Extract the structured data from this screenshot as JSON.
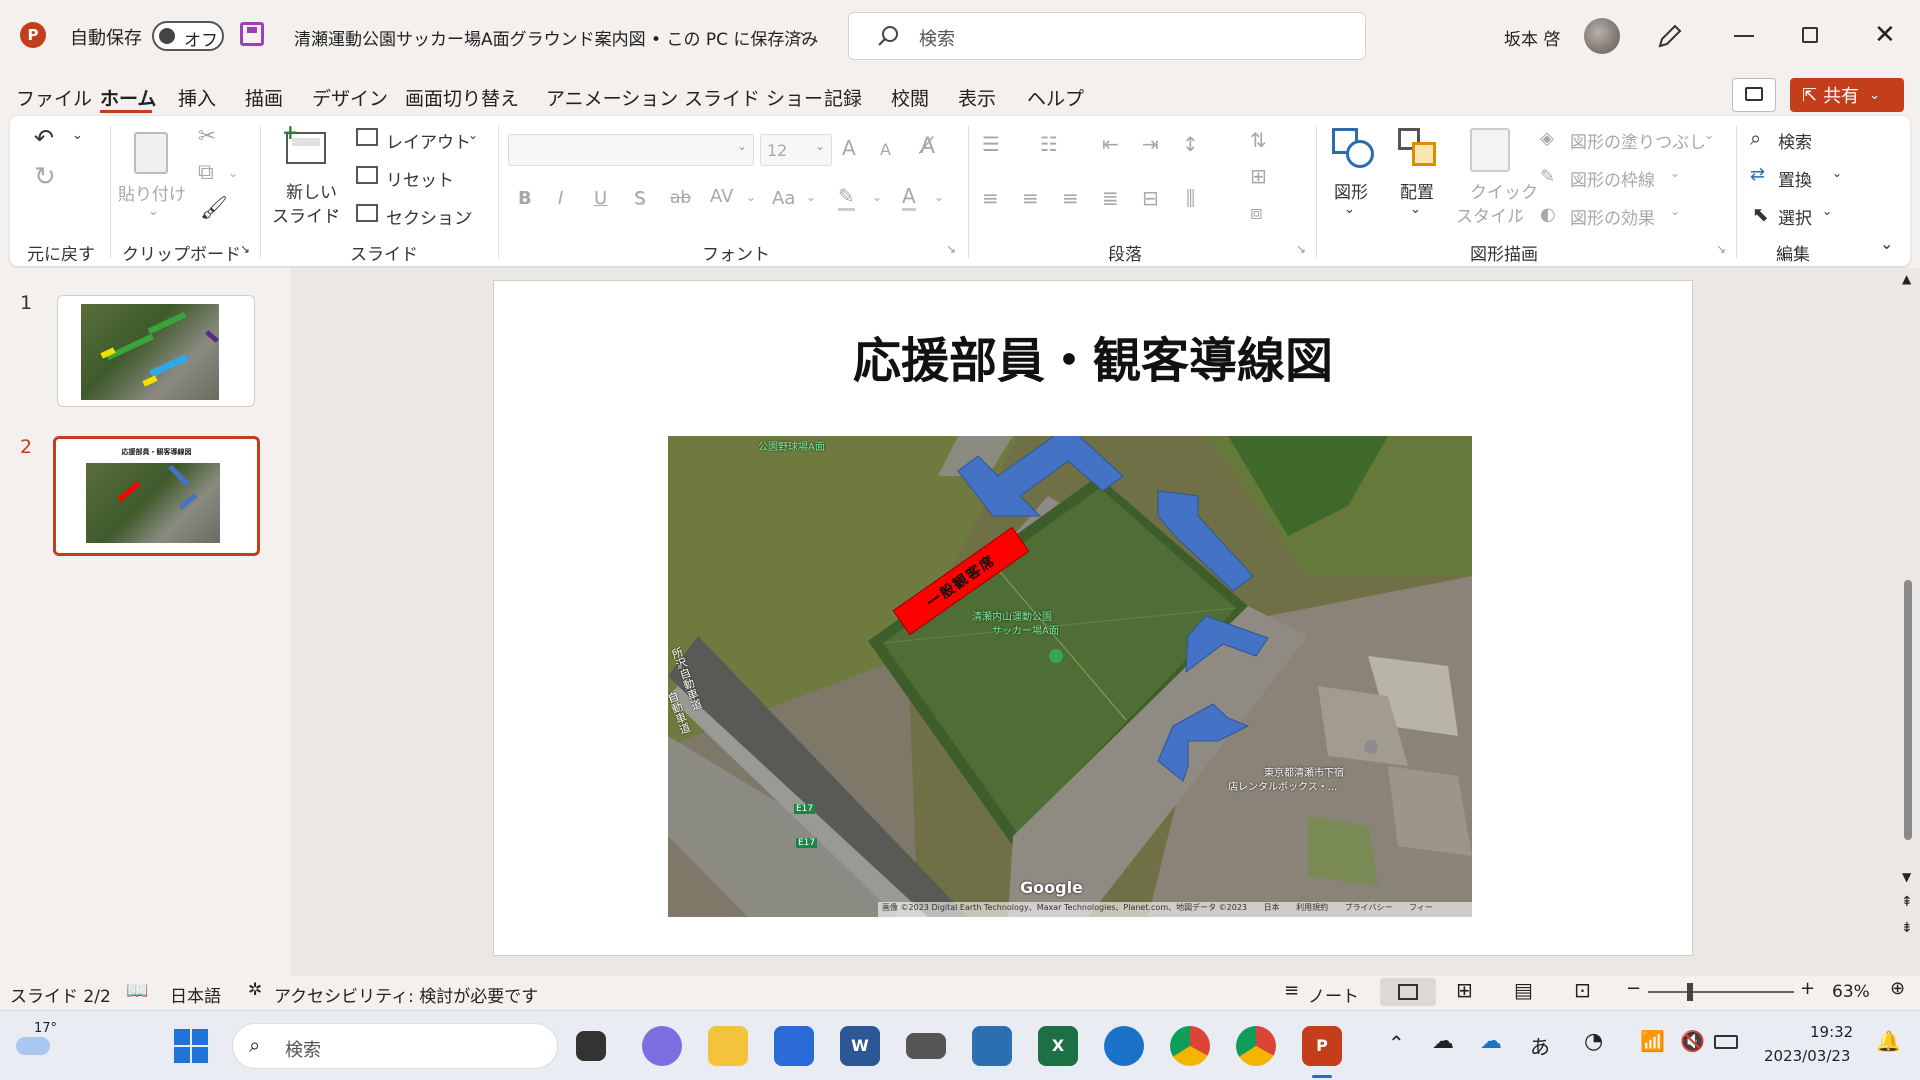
{
  "titlebar": {
    "autosave_label": "自動保存",
    "autosave_state": "オフ",
    "doc_title": "清瀬運動公園サッカー場A面グラウンド案内図 • この PC に保存済み",
    "search_placeholder": "検索",
    "user_name": "坂本 啓"
  },
  "menu": [
    "ファイル",
    "ホーム",
    "挿入",
    "描画",
    "デザイン",
    "画面切り替え",
    "アニメーション",
    "スライド ショー",
    "記録",
    "校閲",
    "表示",
    "ヘルプ"
  ],
  "share_label": "共有",
  "ribbon": {
    "undo_group": "元に戻す",
    "clipboard": {
      "paste": "貼り付け",
      "group": "クリップボード"
    },
    "slides": {
      "new_slide_1": "新しい",
      "new_slide_2": "スライド",
      "layout": "レイアウト",
      "reset": "リセット",
      "section": "セクション",
      "group": "スライド"
    },
    "font": {
      "size": "12",
      "group": "フォント",
      "bold": "B",
      "italic": "I",
      "underline": "U",
      "shadow": "S",
      "strike": "ab",
      "spacing": "AV",
      "case": "Aa",
      "grow": "A",
      "shrink": "A",
      "color": "A"
    },
    "paragraph": {
      "group": "段落"
    },
    "drawing": {
      "shapes": "図形",
      "arrange": "配置",
      "quick_1": "クイック",
      "quick_2": "スタイル",
      "fill": "図形の塗りつぶし",
      "outline": "図形の枠線",
      "effects": "図形の効果",
      "group": "図形描画"
    },
    "editing": {
      "find": "検索",
      "replace": "置換",
      "select": "選択",
      "group": "編集"
    }
  },
  "thumbnails": [
    {
      "number": "1"
    },
    {
      "number": "2",
      "title": "応援部員・観客導線図"
    }
  ],
  "slide": {
    "title": "応援部員・観客導線図",
    "map": {
      "spectator_label": "一般観客席",
      "place_label_1": "清瀬内山運動公園",
      "place_label_2": "サッカー場A面",
      "baseball_label": "公園野球場A面",
      "store_label_1": "東京都清瀬市下宿",
      "store_label_2": "店レンタルボックス・...",
      "road_label_1": "所沢自動車道",
      "road_label_2": "自動車道",
      "route_label": "E17",
      "google": "Google",
      "attribution": "画像 ©2023 Digital Earth Technology、Maxar Technologies、Planet.com、地図データ ©2023",
      "attr_links": [
        "日本",
        "利用規約",
        "プライバシー",
        "フィー"
      ],
      "colors": {
        "field": "#4f6e35",
        "spectator": "#ff0000",
        "arrow": "#4472c4"
      }
    }
  },
  "statusbar": {
    "slide": "スライド 2/2",
    "lang": "日本語",
    "accessibility": "アクセシビリティ: 検討が必要です",
    "notes": "ノート",
    "zoom": "63%"
  },
  "taskbar": {
    "weather": "17°",
    "search": "検索",
    "time": "19:32",
    "date": "2023/03/23",
    "ime": "あ"
  }
}
